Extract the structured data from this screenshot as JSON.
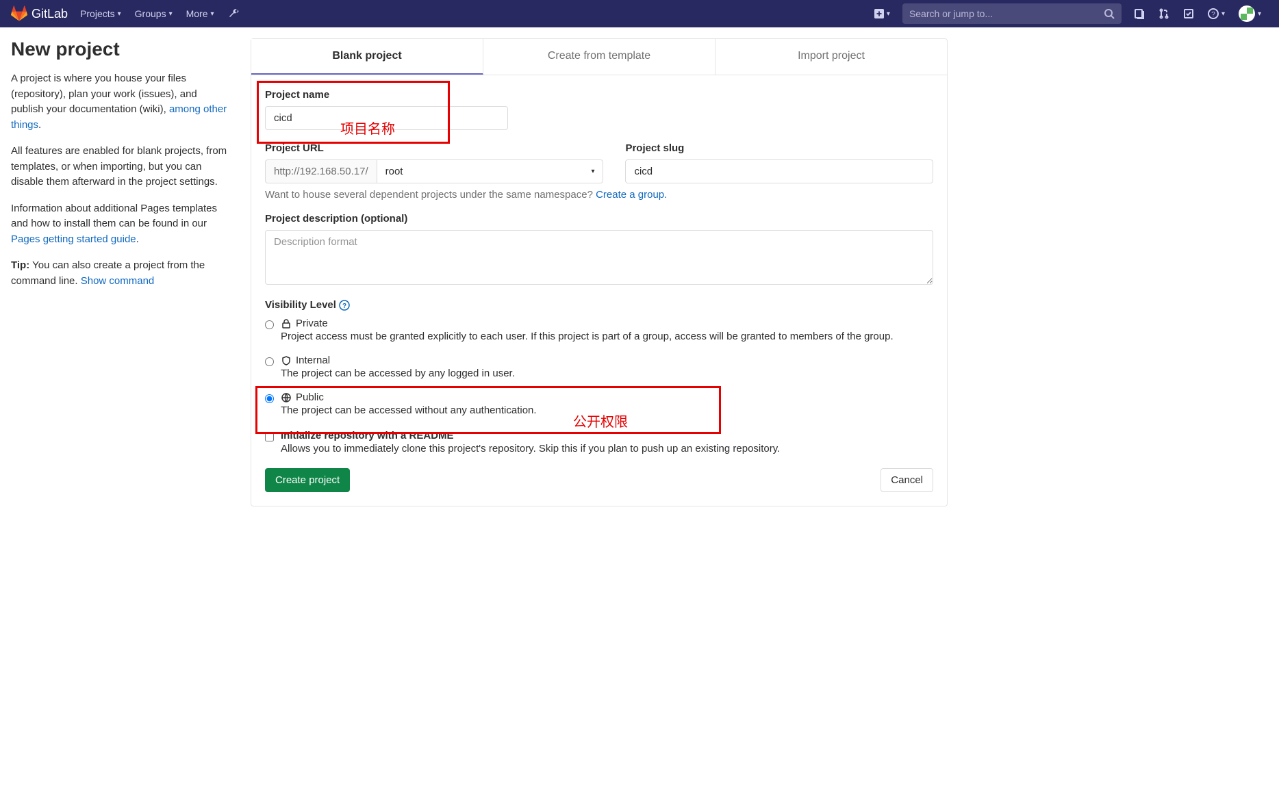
{
  "nav": {
    "brand": "GitLab",
    "projects": "Projects",
    "groups": "Groups",
    "more": "More",
    "search_placeholder": "Search or jump to..."
  },
  "sidebar": {
    "heading": "New project",
    "para1_a": "A project is where you house your files (repository), plan your work (issues), and publish your documentation (wiki), ",
    "para1_link": "among other things",
    "para1_b": ".",
    "para2": "All features are enabled for blank projects, from templates, or when importing, but you can disable them afterward in the project settings.",
    "para3_a": "Information about additional Pages templates and how to install them can be found in our ",
    "para3_link": "Pages getting started guide",
    "para3_b": ".",
    "tip_label": "Tip:",
    "tip_text": " You can also create a project from the command line. ",
    "tip_link": "Show command"
  },
  "tabs": {
    "blank": "Blank project",
    "template": "Create from template",
    "import": "Import project"
  },
  "form": {
    "project_name_label": "Project name",
    "project_name_value": "cicd",
    "project_url_label": "Project URL",
    "project_url_prefix": "http://192.168.50.17/",
    "namespace_selected": "root",
    "project_slug_label": "Project slug",
    "project_slug_value": "cicd",
    "namespace_hint_a": "Want to house several dependent projects under the same namespace? ",
    "namespace_hint_link": "Create a group.",
    "description_label": "Project description (optional)",
    "description_placeholder": "Description format",
    "visibility_label": "Visibility Level",
    "visibility": {
      "private_title": "Private",
      "private_desc": "Project access must be granted explicitly to each user. If this project is part of a group, access will be granted to members of the group.",
      "internal_title": "Internal",
      "internal_desc": "The project can be accessed by any logged in user.",
      "public_title": "Public",
      "public_desc": "The project can be accessed without any authentication."
    },
    "readme_title": "Initialize repository with a README",
    "readme_desc": "Allows you to immediately clone this project's repository. Skip this if you plan to push up an existing repository.",
    "create_btn": "Create project",
    "cancel_btn": "Cancel"
  },
  "annotations": {
    "project_name": "项目名称",
    "public_perm": "公开权限"
  }
}
